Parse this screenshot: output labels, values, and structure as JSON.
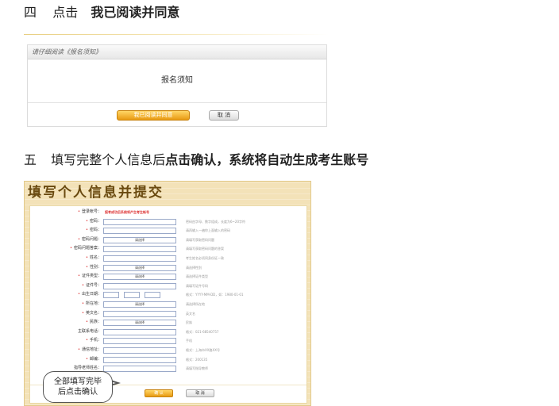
{
  "step4": {
    "number": "四",
    "action": "点击",
    "target": "我已阅读并同意"
  },
  "notice_panel": {
    "header": "请仔细阅读《报名须知》",
    "body_title": "报名须知",
    "agree_button": "我已阅读并同意",
    "cancel_button": "取 消"
  },
  "step5": {
    "number": "五",
    "text_plain": "填写完整个人信息后",
    "text_bold": "点击确认，系统将自动生成考生账号"
  },
  "form": {
    "title": "填写个人信息并提交",
    "rows": [
      {
        "label": "登录帐号：",
        "req": true,
        "field": "text",
        "hint": "报考成功后系统将产生考生帐号",
        "hint_red": true
      },
      {
        "label": "密码：",
        "req": true,
        "field": "input",
        "hint": "密码由字母、数字组成，长度为6~20字符"
      },
      {
        "label": "密码：",
        "req": true,
        "field": "input",
        "hint": "请再输入一遍你上面输入的密码"
      },
      {
        "label": "密码问题：",
        "req": true,
        "field": "select",
        "value": "请选择",
        "hint": "请填写获取密码问题"
      },
      {
        "label": "密码问题答案：",
        "req": true,
        "field": "input",
        "hint": "请填写获取密码问题的答案"
      },
      {
        "label": "姓名：",
        "req": true,
        "field": "input",
        "hint": "考生姓名必须同身份证一致"
      },
      {
        "label": "性别：",
        "req": true,
        "field": "select",
        "value": "请选择",
        "hint": "请选择性别"
      },
      {
        "label": "证件类型：",
        "req": true,
        "field": "select",
        "value": "请选择",
        "hint": "请选择证件类型"
      },
      {
        "label": "证件号：",
        "req": true,
        "field": "input",
        "hint": "请填写证件号码"
      },
      {
        "label": "出生日期：",
        "req": true,
        "field": "date",
        "hint": "格式：YYYY-MM-DD，如：1980-01-01"
      },
      {
        "label": "所在地：",
        "req": true,
        "field": "select",
        "value": "请选择",
        "hint": "请选择所在地"
      },
      {
        "label": "英文名：",
        "req": true,
        "field": "input",
        "hint": "英文名"
      },
      {
        "label": "民族：",
        "req": true,
        "field": "select",
        "value": "请选择",
        "hint": "民族"
      },
      {
        "label": "主联系电话：",
        "req": false,
        "field": "input",
        "hint": "格式：021-68540757"
      },
      {
        "label": "手机：",
        "req": true,
        "field": "input",
        "hint": "手机"
      },
      {
        "label": "通信地址：",
        "req": true,
        "field": "input",
        "hint": "格式：上海市XX路XX号"
      },
      {
        "label": "邮编：",
        "req": true,
        "field": "input",
        "hint": "格式：200135"
      },
      {
        "label": "指导老师姓名：",
        "req": false,
        "field": "input",
        "hint": "请填写指导教师"
      }
    ],
    "confirm_button": "确 认",
    "cancel_button": "取 消"
  },
  "callout": {
    "line1": "全部填写完毕",
    "line2": "后点击确认"
  },
  "colors": {
    "accent_gold": "#e89a12",
    "form_bg": "#f3e2b8",
    "required_red": "#d33333"
  }
}
